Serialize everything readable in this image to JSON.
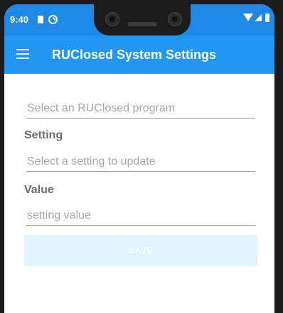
{
  "status_bar": {
    "time": "9:40",
    "icons": [
      "sim-card-icon",
      "sync-icon",
      "wifi-icon",
      "cell-signal-icon",
      "battery-icon"
    ]
  },
  "app_bar": {
    "title": "RUClosed System Settings",
    "menu_icon": "hamburger-menu-icon",
    "color": "#2196f3"
  },
  "form": {
    "program": {
      "placeholder": "Select an RUClosed program",
      "value": ""
    },
    "setting": {
      "label": "Setting",
      "placeholder": "Select a setting to update",
      "value": ""
    },
    "value": {
      "label": "Value",
      "placeholder": "setting value",
      "value": ""
    },
    "save_label": "SAVE"
  },
  "colors": {
    "status_bar": "#1e88e5",
    "app_bar": "#2196f3",
    "save_button_disabled": "#e1f4fd"
  }
}
